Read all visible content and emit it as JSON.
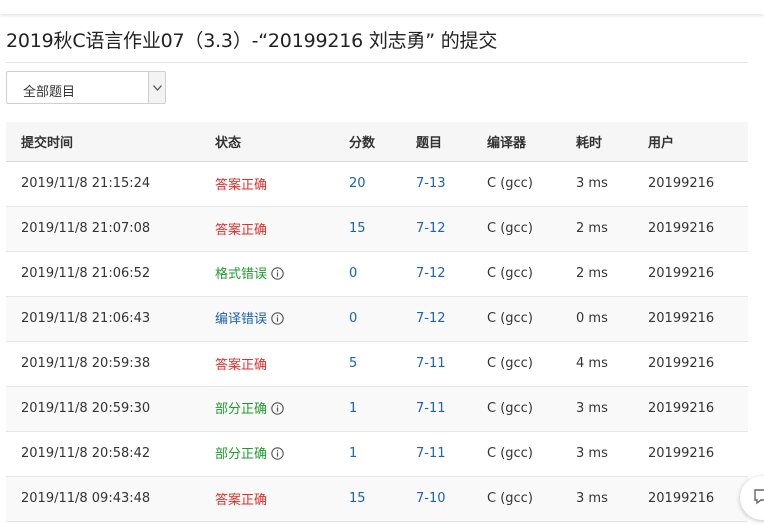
{
  "page": {
    "title": "2019秋C语言作业07（3.3）-“20199216 刘志勇” 的提交"
  },
  "filter": {
    "selected": "全部题目"
  },
  "table": {
    "headers": [
      "提交时间",
      "状态",
      "分数",
      "题目",
      "编译器",
      "耗时",
      "用户"
    ],
    "rows": [
      {
        "time": "2019/11/8 21:15:24",
        "status": "答案正确",
        "status_color": "red",
        "info": false,
        "score": "20",
        "problem": "7-13",
        "compiler": "C (gcc)",
        "cost": "3 ms",
        "user": "20199216"
      },
      {
        "time": "2019/11/8 21:07:08",
        "status": "答案正确",
        "status_color": "red",
        "info": false,
        "score": "15",
        "problem": "7-12",
        "compiler": "C (gcc)",
        "cost": "2 ms",
        "user": "20199216"
      },
      {
        "time": "2019/11/8 21:06:52",
        "status": "格式错误",
        "status_color": "green",
        "info": true,
        "score": "0",
        "problem": "7-12",
        "compiler": "C (gcc)",
        "cost": "2 ms",
        "user": "20199216"
      },
      {
        "time": "2019/11/8 21:06:43",
        "status": "编译错误",
        "status_color": "blue",
        "info": true,
        "score": "0",
        "problem": "7-12",
        "compiler": "C (gcc)",
        "cost": "0 ms",
        "user": "20199216"
      },
      {
        "time": "2019/11/8 20:59:38",
        "status": "答案正确",
        "status_color": "red",
        "info": false,
        "score": "5",
        "problem": "7-11",
        "compiler": "C (gcc)",
        "cost": "4 ms",
        "user": "20199216"
      },
      {
        "time": "2019/11/8 20:59:30",
        "status": "部分正确",
        "status_color": "green",
        "info": true,
        "score": "1",
        "problem": "7-11",
        "compiler": "C (gcc)",
        "cost": "3 ms",
        "user": "20199216"
      },
      {
        "time": "2019/11/8 20:58:42",
        "status": "部分正确",
        "status_color": "green",
        "info": true,
        "score": "1",
        "problem": "7-11",
        "compiler": "C (gcc)",
        "cost": "3 ms",
        "user": "20199216"
      },
      {
        "time": "2019/11/8 09:43:48",
        "status": "答案正确",
        "status_color": "red",
        "info": false,
        "score": "15",
        "problem": "7-10",
        "compiler": "C (gcc)",
        "cost": "3 ms",
        "user": "20199216"
      }
    ]
  },
  "colors": {
    "red": "#e0302c",
    "green": "#1f9d2c",
    "blue": "#1a62b7",
    "link": "#1a62b7"
  },
  "icons": {
    "info": "info-circle-icon",
    "dropdown": "chevron-down-icon",
    "feedback": "feedback-icon"
  }
}
